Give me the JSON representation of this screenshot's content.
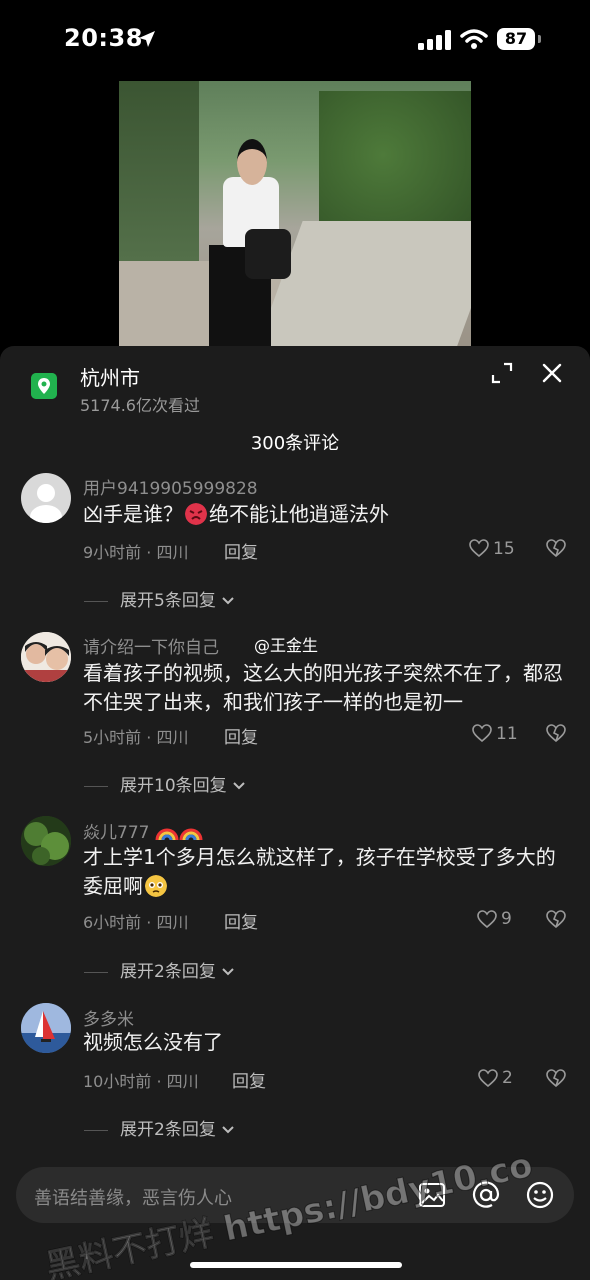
{
  "status_bar": {
    "time": "20:38",
    "battery": "87"
  },
  "location": {
    "title": "杭州市",
    "views": "5174.6亿次看过"
  },
  "comments_header": {
    "count_label": "300条评论"
  },
  "comments": [
    {
      "user": "用户9419905999828",
      "text_pre": "凶手是谁？",
      "text_post": "绝不能让他逍遥法外",
      "meta": "9小时前 · 四川",
      "reply": "回复",
      "likes": "15",
      "expand": "展开5条回复"
    },
    {
      "user": "请介绍一下你自己",
      "tag": "@王金生",
      "text": "看着孩子的视频，这么大的阳光孩子突然不在了，都忍不住哭了出来，和我们孩子一样的也是初一",
      "meta": "5小时前 · 四川",
      "reply": "回复",
      "likes": "11",
      "expand": "展开10条回复"
    },
    {
      "user": "焱儿777",
      "text": "才上学1个多月怎么就这样了，孩子在学校受了多大的委屈啊",
      "meta": "6小时前 · 四川",
      "reply": "回复",
      "likes": "9",
      "expand": "展开2条回复"
    },
    {
      "user": "多多米",
      "text": "视频怎么没有了",
      "meta": "10小时前 · 四川",
      "reply": "回复",
      "likes": "2",
      "expand": "展开2条回复"
    }
  ],
  "input": {
    "placeholder": "善语结善缘，恶言伤人心"
  },
  "watermark": "黑料不打烊 https://bdy10.co",
  "colors": {
    "pin": "#21b24e",
    "sheet": "#1c1c1c",
    "angry_emoji": "#e0334a",
    "pleading_emoji": "#f5c542"
  },
  "icons": [
    "location-arrow-icon",
    "signal-icon",
    "wifi-icon",
    "battery-icon",
    "map-pin-icon",
    "expand-icon",
    "close-icon",
    "heart-icon",
    "dislike-icon",
    "chevron-down-icon",
    "image-icon",
    "at-icon",
    "emoji-icon"
  ]
}
